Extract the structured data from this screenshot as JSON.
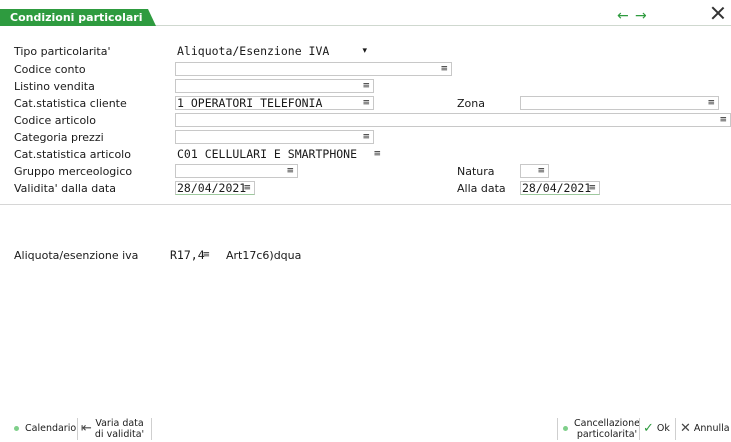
{
  "window": {
    "title": "Condizioni particolari"
  },
  "nav": {
    "back": "←",
    "forward": "→"
  },
  "form": {
    "tipo_particolarita": {
      "label": "Tipo particolarita'",
      "value": "Aliquota/Esenzione IVA"
    },
    "codice_conto": {
      "label": "Codice conto",
      "value": ""
    },
    "listino_vendita": {
      "label": "Listino vendita",
      "value": ""
    },
    "cat_statistica_cliente": {
      "label": "Cat.statistica cliente",
      "value": "1 OPERATORI TELEFONIA"
    },
    "zona": {
      "label": "Zona",
      "value": ""
    },
    "codice_articolo": {
      "label": "Codice articolo",
      "value": ""
    },
    "categoria_prezzi": {
      "label": "Categoria prezzi",
      "value": ""
    },
    "cat_statistica_articolo": {
      "label": "Cat.statistica articolo",
      "value": "C01 CELLULARI E SMARTPHONE"
    },
    "gruppo_merceologico": {
      "label": "Gruppo merceologico",
      "value": ""
    },
    "natura": {
      "label": "Natura",
      "value": ""
    },
    "validita_dalla_data": {
      "label": "Validita' dalla data",
      "value": "28/04/2021"
    },
    "alla_data": {
      "label": "Alla data",
      "value": "28/04/2021"
    },
    "aliquota_esenzione_iva": {
      "label": "Aliquota/esenzione iva",
      "value": "R17,4",
      "description": "Art17c6)dqua"
    }
  },
  "toolbar": {
    "calendario": "Calendario",
    "varia_data_1": "Varia data",
    "varia_data_2": "di validita'",
    "cancellazione_1": "Cancellazione",
    "cancellazione_2": "particolarita'",
    "ok": "Ok",
    "annulla": "Annulla"
  },
  "colors": {
    "accent": "#2e9b3f",
    "field_border": "#c8c8c8"
  },
  "icons": [
    "arrow-left-icon",
    "arrow-right-icon",
    "close-icon",
    "dropdown-arrow-icon",
    "field-menu-icon",
    "check-icon",
    "x-icon",
    "back-to-start-icon"
  ]
}
